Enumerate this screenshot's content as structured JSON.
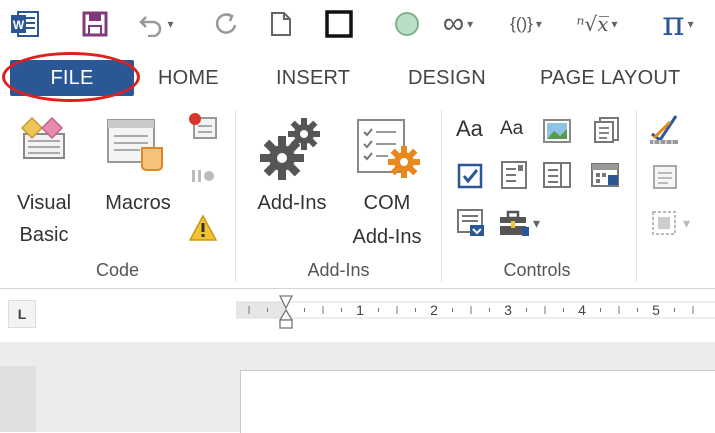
{
  "quick_access": {
    "word_icon": "word-app-icon",
    "save_icon": "save-icon",
    "undo_icon": "undo-icon",
    "redo_icon": "redo-icon",
    "new_doc_icon": "new-document-icon",
    "border_icon": "square-border-icon",
    "shape_icon": "circle-shape-icon",
    "infinity_glyph": "∞",
    "braces_glyph": "{()}",
    "root_glyph": "ⁿ√x̅",
    "pi_glyph": "π"
  },
  "tabs": [
    {
      "label": "FILE"
    },
    {
      "label": "HOME"
    },
    {
      "label": "INSERT"
    },
    {
      "label": "DESIGN"
    },
    {
      "label": "PAGE LAYOUT"
    }
  ],
  "ribbon": {
    "code": {
      "label": "Code",
      "visual_basic": "Visual Basic",
      "visual_basic_l1": "Visual",
      "visual_basic_l2": "Basic",
      "macros": "Macros"
    },
    "addins": {
      "label": "Add-Ins",
      "addins_button": "Add-Ins",
      "com_l1": "COM",
      "com_l2": "Add-Ins"
    },
    "controls": {
      "label": "Controls",
      "aa1": "Aa",
      "aa2": "Aa"
    }
  },
  "ruler": {
    "tab_selector": "L",
    "numbers": [
      "1",
      "2",
      "3",
      "4",
      "5"
    ]
  },
  "colors": {
    "file_tab": "#2b5797",
    "highlight_ring": "#e0201c",
    "word_blue": "#2b5797",
    "save_purple": "#80397b",
    "addins_orange": "#e8891f",
    "pi_blue": "#2b5797"
  }
}
